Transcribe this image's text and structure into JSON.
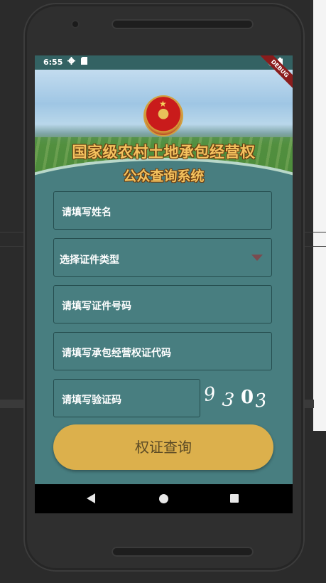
{
  "statusbar": {
    "time": "6:55",
    "left_icons": [
      "gear-icon",
      "sd-card-icon"
    ],
    "right_icons": [
      "wifi-icon",
      "battery-icon"
    ],
    "debug_banner": "DEBUG"
  },
  "header": {
    "title_line1": "国家级农村土地承包经营权",
    "title_line2": "公众查询系统",
    "emblem": "national-emblem"
  },
  "form": {
    "name_placeholder": "请填写姓名",
    "id_type_placeholder": "选择证件类型",
    "id_number_placeholder": "请填写证件号码",
    "cert_code_placeholder": "请填写承包经营权证代码",
    "captcha_placeholder": "请填写验证码",
    "captcha_chars": [
      "9",
      "3",
      "0",
      "3"
    ],
    "submit_label": "权证查询"
  },
  "colors": {
    "screen_bg": "#487e80",
    "button_bg": "#dcb04c",
    "title_gold": "#f4c25e"
  }
}
